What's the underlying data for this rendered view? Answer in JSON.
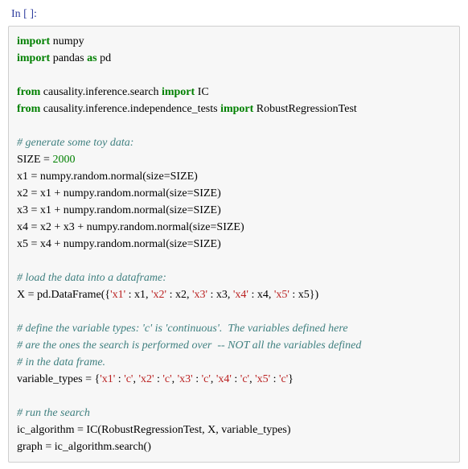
{
  "prompt": "In [ ]:",
  "code": {
    "l01a": "import",
    "l01b": " numpy",
    "l02a": "import",
    "l02b": " pandas ",
    "l02c": "as",
    "l02d": " pd",
    "blank1": "",
    "l04a": "from",
    "l04b": " causality.inference.search ",
    "l04c": "import",
    "l04d": " IC",
    "l05a": "from",
    "l05b": " causality.inference.independence_tests ",
    "l05c": "import",
    "l05d": " RobustRegressionTest",
    "blank2": "",
    "c1": "# generate some toy data:",
    "l08a": "SIZE = ",
    "l08b": "2000",
    "l09": "x1 = numpy.random.normal(size=SIZE)",
    "l10": "x2 = x1 + numpy.random.normal(size=SIZE)",
    "l11": "x3 = x1 + numpy.random.normal(size=SIZE)",
    "l12": "x4 = x2 + x3 + numpy.random.normal(size=SIZE)",
    "l13": "x5 = x4 + numpy.random.normal(size=SIZE)",
    "blank3": "",
    "c2": "# load the data into a dataframe:",
    "l16a": "X = pd.DataFrame({",
    "s_x1": "'x1'",
    "l16b": " : x1, ",
    "s_x2": "'x2'",
    "l16c": " : x2, ",
    "s_x3": "'x3'",
    "l16d": " : x3, ",
    "s_x4": "'x4'",
    "l16e": " : x4, ",
    "s_x5": "'x5'",
    "l16f": " : x5})",
    "blank4": "",
    "c3": "# define the variable types: 'c' is 'continuous'.  The variables defined here",
    "c4": "# are the ones the search is performed over  -- NOT all the variables defined",
    "c5": "# in the data frame.",
    "l21a": "variable_types = {",
    "vs_x1": "'x1'",
    "l21b": " : ",
    "vs_c1": "'c'",
    "l21c": ", ",
    "vs_x2": "'x2'",
    "l21d": " : ",
    "vs_c2": "'c'",
    "l21e": ", ",
    "vs_x3": "'x3'",
    "l21f": " : ",
    "vs_c3": "'c'",
    "l21g": ", ",
    "vs_x4": "'x4'",
    "l21h": " : ",
    "vs_c4": "'c'",
    "l21i": ", ",
    "vs_x5": "'x5'",
    "l21j": " : ",
    "vs_c5": "'c'",
    "l21k": "}",
    "blank5": "",
    "c6": "# run the search",
    "l24": "ic_algorithm = IC(RobustRegressionTest, X, variable_types)",
    "l25": "graph = ic_algorithm.search()"
  }
}
